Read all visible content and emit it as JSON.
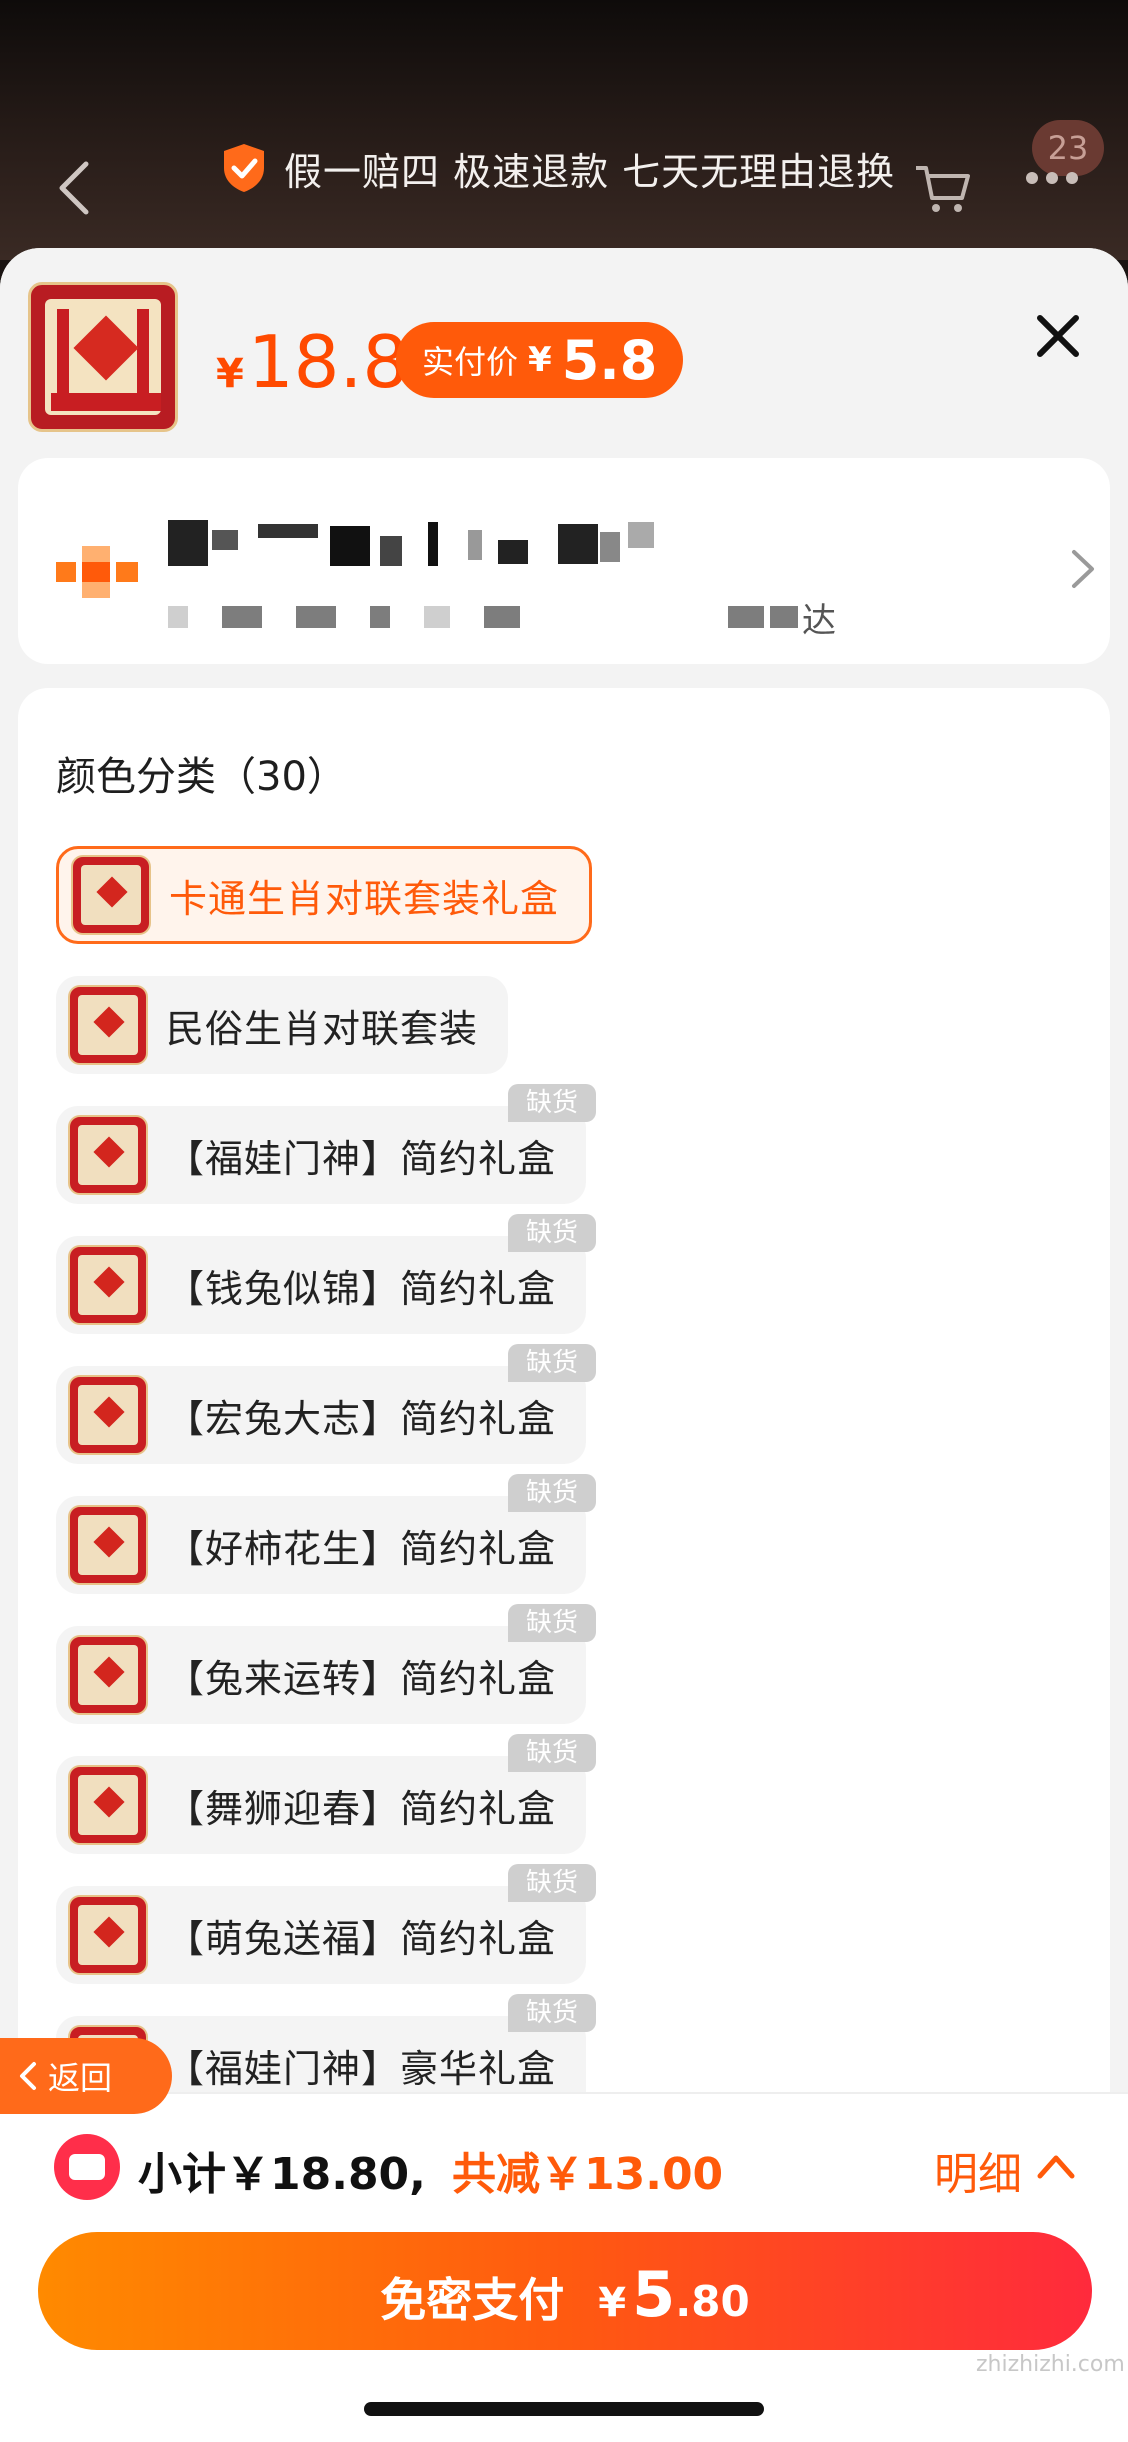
{
  "header": {
    "guarantee_text": "假一赔四 极速退款 七天无理由退换",
    "cart_badge": "23"
  },
  "sku": {
    "currency": "¥",
    "price": "18.8",
    "paid_label": "实付价",
    "paid_currency": "¥",
    "paid_price": "5.8"
  },
  "address": {
    "tail_text": "达"
  },
  "options_section": {
    "title": "颜色分类（30）",
    "out_of_stock_label": "缺货",
    "items": [
      {
        "label": "卡通生肖对联套装礼盒",
        "selected": true,
        "out_of_stock": false
      },
      {
        "label": "民俗生肖对联套装",
        "selected": false,
        "out_of_stock": false
      },
      {
        "label": "【福娃门神】简约礼盒",
        "selected": false,
        "out_of_stock": true
      },
      {
        "label": "【钱兔似锦】简约礼盒",
        "selected": false,
        "out_of_stock": true
      },
      {
        "label": "【宏兔大志】简约礼盒",
        "selected": false,
        "out_of_stock": true
      },
      {
        "label": "【好柿花生】简约礼盒",
        "selected": false,
        "out_of_stock": true
      },
      {
        "label": "【兔来运转】简约礼盒",
        "selected": false,
        "out_of_stock": true
      },
      {
        "label": "【舞狮迎春】简约礼盒",
        "selected": false,
        "out_of_stock": true
      },
      {
        "label": "【萌兔送福】简约礼盒",
        "selected": false,
        "out_of_stock": true
      },
      {
        "label": "【福娃门神】豪华礼盒",
        "selected": false,
        "out_of_stock": true
      }
    ]
  },
  "return_button": {
    "label": "返回"
  },
  "summary": {
    "subtotal": "小计￥18.80,",
    "discount": "共减￥13.00",
    "detail_label": "明细"
  },
  "pay": {
    "label": "免密支付",
    "currency": "¥",
    "amount_int": "5",
    "amount_dec": ".80"
  },
  "watermark": "zhizhizhi.com",
  "colors": {
    "accent": "#ff5a0a",
    "pay_gradient_start": "#ff8a00",
    "pay_gradient_end": "#ff2a3c"
  }
}
